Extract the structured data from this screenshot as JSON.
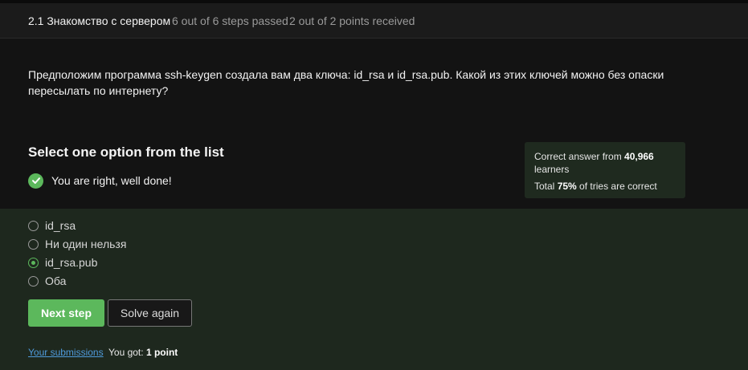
{
  "header": {
    "title": "2.1 Знакомство с сервером",
    "steps": "6 out of 6 steps passed",
    "points": "2 out of 2 points  received"
  },
  "question": "Предположим программа ssh-keygen создала вам два ключа: id_rsa и id_rsa.pub. Какой из этих ключей можно без опаски пересылать по интернету?",
  "quiz": {
    "title": "Select one option from the list",
    "result": "You are right, well done!"
  },
  "stats": {
    "correct_prefix": "Correct answer from ",
    "learners_count": "40,966",
    "learners_suffix": "learners",
    "total_prefix": "Total ",
    "percent": "75%",
    "total_suffix": " of tries are correct"
  },
  "options": [
    {
      "label": "id_rsa",
      "selected": false
    },
    {
      "label": "Ни один нельзя",
      "selected": false
    },
    {
      "label": "id_rsa.pub",
      "selected": true
    },
    {
      "label": "Оба",
      "selected": false
    }
  ],
  "buttons": {
    "next": "Next step",
    "solve_again": "Solve again"
  },
  "footer": {
    "submissions_link": "Your submissions",
    "got_prefix": "You got: ",
    "got_value": "1 point"
  },
  "colors": {
    "accent": "#5cb85c",
    "link": "#4f9bdc",
    "background": "#131313",
    "options_background": "#1e281e"
  }
}
